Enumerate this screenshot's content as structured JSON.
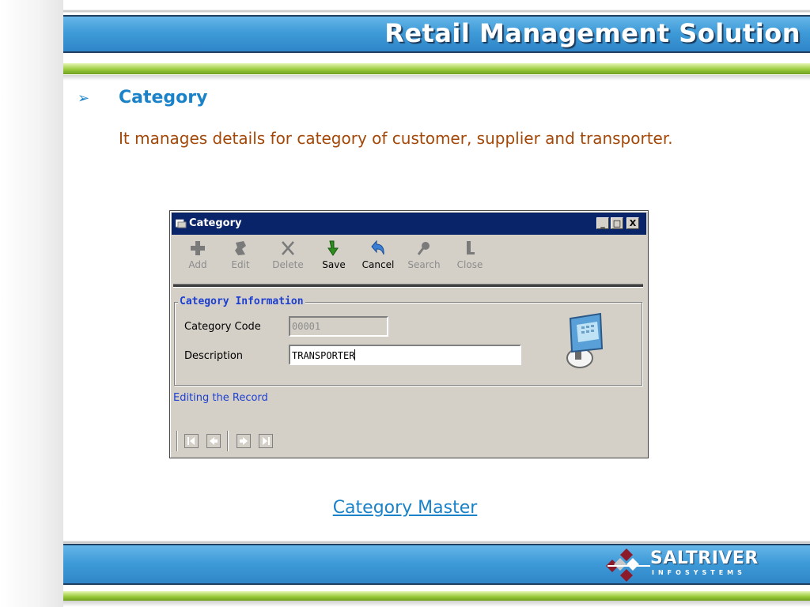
{
  "header": {
    "title": "Retail Management Solution"
  },
  "section": {
    "title": "Category",
    "description": "It manages details for category of customer, supplier and transporter."
  },
  "window": {
    "title": "Category",
    "controls": {
      "minimize": "_",
      "maximize": "□",
      "close": "X"
    },
    "toolbar": [
      {
        "label": "Add",
        "icon": "plus-icon",
        "enabled": false
      },
      {
        "label": "Edit",
        "icon": "edit-icon",
        "enabled": false
      },
      {
        "label": "Delete",
        "icon": "delete-icon",
        "enabled": false
      },
      {
        "label": "Save",
        "icon": "save-arrow-icon",
        "enabled": true
      },
      {
        "label": "Cancel",
        "icon": "cancel-arrow-icon",
        "enabled": true
      },
      {
        "label": "Search",
        "icon": "search-icon",
        "enabled": false
      },
      {
        "label": "Close",
        "icon": "close-door-icon",
        "enabled": false
      }
    ],
    "group": {
      "title": "Category Information",
      "fields": {
        "code": {
          "label": "Category Code",
          "value": "00001"
        },
        "description": {
          "label": "Description",
          "value": "TRANSPORTER"
        }
      }
    },
    "status": "Editing the Record",
    "navigation": [
      "first-record-icon",
      "previous-record-icon",
      "next-record-icon",
      "last-record-icon"
    ]
  },
  "caption": "Category Master",
  "footer": {
    "logo_name": "SALTRIVER",
    "logo_sub": "INFOSYSTEMS"
  },
  "colors": {
    "accent_blue": "#1a82c8",
    "description_brown": "#a34808",
    "titlebar_navy": "#0a246a",
    "bar_green": "#9ccc3e",
    "bar_blue": "#3f9bd8"
  }
}
